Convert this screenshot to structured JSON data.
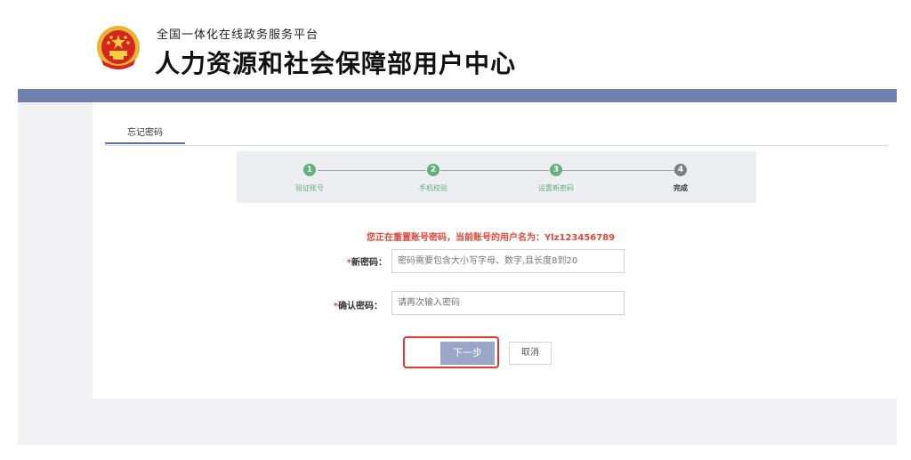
{
  "header": {
    "platform_name": "全国一体化在线政务服务平台",
    "site_title": "人力资源和社会保障部用户中心",
    "emblem_icon": "national-emblem-icon"
  },
  "tabs": [
    {
      "label": "忘记密码",
      "active": true
    }
  ],
  "steps": [
    {
      "number": "1",
      "label": "验证账号",
      "status": "done"
    },
    {
      "number": "2",
      "label": "手机校验",
      "status": "done"
    },
    {
      "number": "3",
      "label": "设置新密码",
      "status": "done"
    },
    {
      "number": "4",
      "label": "完成",
      "status": "pending"
    }
  ],
  "notice": "您正在重置账号密码，当前账号的用户名为：Ylz123456789",
  "form": {
    "required_mark": "*",
    "new_password": {
      "label": "新密码：",
      "placeholder": "密码需要包含大小写字母、数字,且长度8到20"
    },
    "confirm_password": {
      "label": "确认密码：",
      "placeholder": "请再次输入密码"
    }
  },
  "buttons": {
    "next": "下一步",
    "cancel": "取消"
  },
  "colors": {
    "brand_bar": "#6f7fb0",
    "step_done": "#62b07c",
    "step_pending": "#7d7d7d",
    "notice_red": "#e0483a",
    "highlight_red": "#e23a2a",
    "button_primary": "#9aa6c8"
  }
}
